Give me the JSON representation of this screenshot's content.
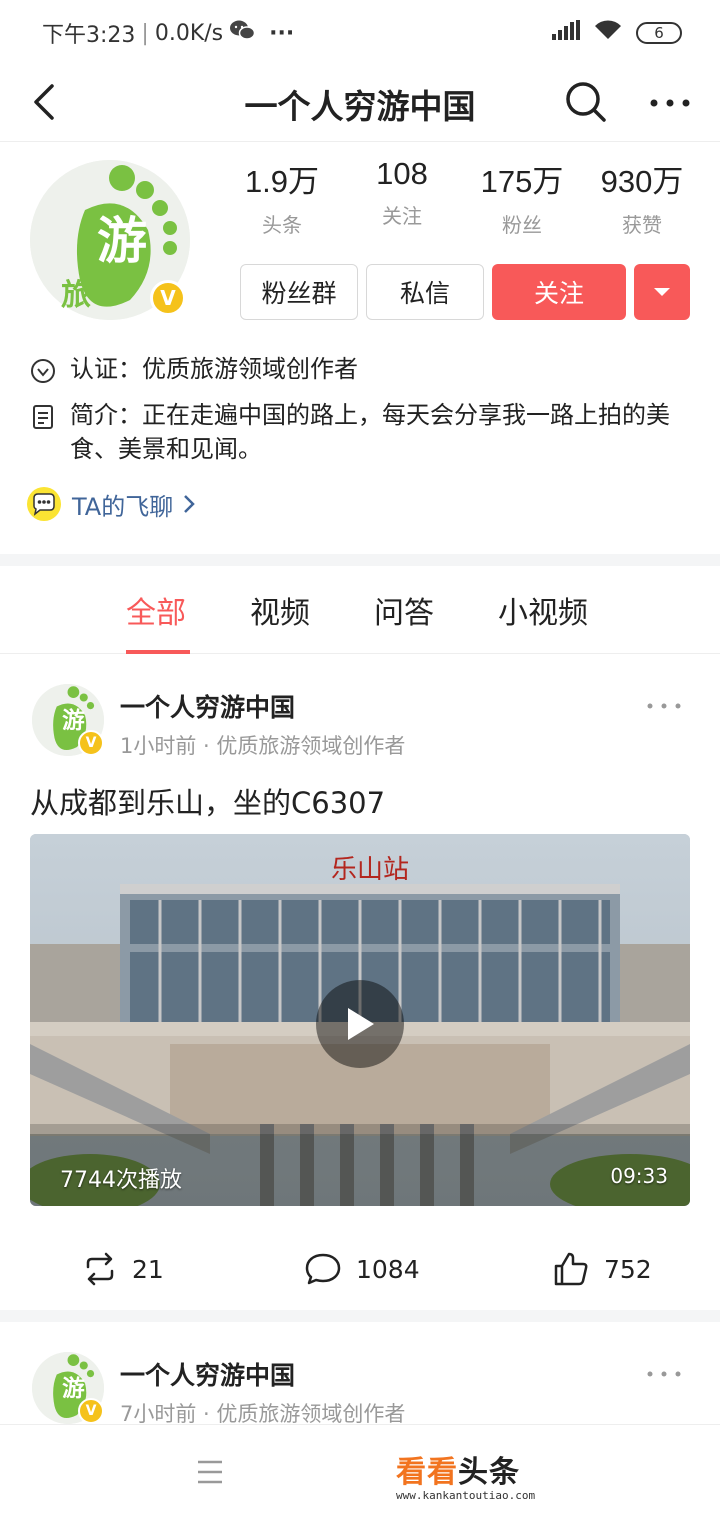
{
  "status_bar": {
    "time": "下午3:23",
    "speed": "0.0K/s",
    "dots": "···",
    "battery": "6"
  },
  "nav": {
    "title": "一个人穷游中国"
  },
  "profile": {
    "avatar_text_main": "游",
    "avatar_text_sub": "旅",
    "verified_badge": "V",
    "stats": [
      {
        "value": "1.9万",
        "label": "头条"
      },
      {
        "value": "108",
        "label": "关注"
      },
      {
        "value": "175万",
        "label": "粉丝"
      },
      {
        "value": "930万",
        "label": "获赞"
      }
    ],
    "buttons": {
      "fan_group": "粉丝群",
      "message": "私信",
      "follow": "关注"
    },
    "verify_text": "认证：优质旅游领域创作者",
    "intro_text": "简介：正在走遍中国的路上，每天会分享我一路上拍的美食、美景和见闻。",
    "chat_link": "TA的飞聊"
  },
  "tabs": [
    {
      "label": "全部",
      "active": true
    },
    {
      "label": "视频",
      "active": false
    },
    {
      "label": "问答",
      "active": false
    },
    {
      "label": "小视频",
      "active": false
    }
  ],
  "posts": [
    {
      "author": "一个人穷游中国",
      "meta": "1小时前 · 优质旅游领域创作者",
      "text": "从成都到乐山，坐的C6307",
      "video": {
        "station_sign": "乐山站",
        "plays": "7744次播放",
        "duration": "09:33"
      },
      "actions": {
        "reposts": "21",
        "comments": "1084",
        "likes": "752"
      }
    },
    {
      "author": "一个人穷游中国",
      "meta": "7小时前 · 优质旅游领域创作者"
    }
  ],
  "watermark": {
    "part1": "看看",
    "part2": "头条",
    "url": "www.kankantoutiao.com"
  },
  "colors": {
    "accent_red": "#f85959",
    "link_blue": "#406599",
    "badge_yellow": "#f5c21b",
    "logo_green": "#7ac142"
  }
}
